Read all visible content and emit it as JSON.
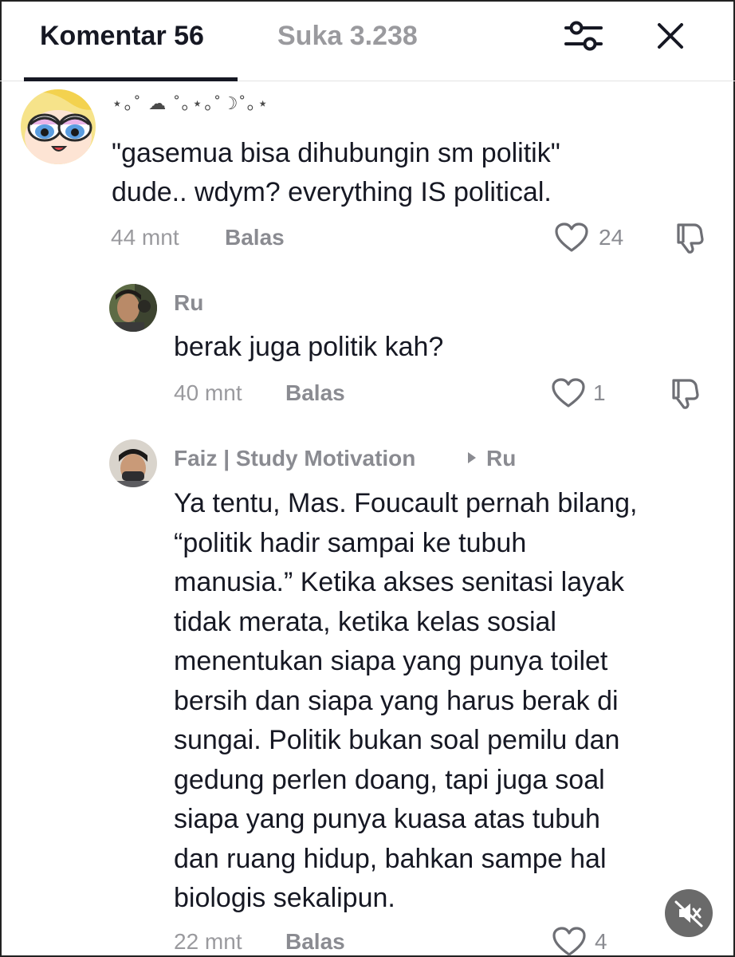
{
  "header": {
    "tab_comments": "Komentar 56",
    "tab_likes": "Suka 3.238",
    "filter_icon": "filter-sliders-icon",
    "close_icon": "close-icon"
  },
  "comments": [
    {
      "username": "⋆｡˚ ☁︎ ˚｡⋆｡˚☽˚｡⋆",
      "avatar": "powerpuff-bubbles-avatar",
      "line1": "\"gasemua bisa dihubungin sm politik\"",
      "line2": "dude.. wdym? everything IS political.",
      "time": "44 mnt",
      "reply": "Balas",
      "likes": "24"
    },
    {
      "username": "Ru",
      "avatar": "user-photo-avatar",
      "line1": "berak juga politik kah?",
      "time": "40 mnt",
      "reply": "Balas",
      "likes": "1"
    },
    {
      "username": "Faiz | Study Motivation",
      "reply_to": "Ru",
      "avatar": "user-photo-avatar",
      "lines": [
        "Ya tentu, Mas. Foucault pernah bilang,",
        "“politik hadir sampai ke tubuh",
        "manusia.” Ketika akses senitasi layak",
        "tidak merata, ketika kelas sosial",
        "menentukan siapa yang punya toilet",
        "bersih dan siapa yang harus berak di",
        "sungai. Politik bukan soal pemilu dan",
        "gedung perlen doang, tapi juga soal",
        "siapa yang punya kuasa atas tubuh",
        "dan ruang hidup, bahkan sampe hal",
        "biologis sekalipun."
      ],
      "time": "22 mnt",
      "reply": "Balas",
      "likes": "4"
    }
  ],
  "mute_icon": "speaker-muted-icon"
}
